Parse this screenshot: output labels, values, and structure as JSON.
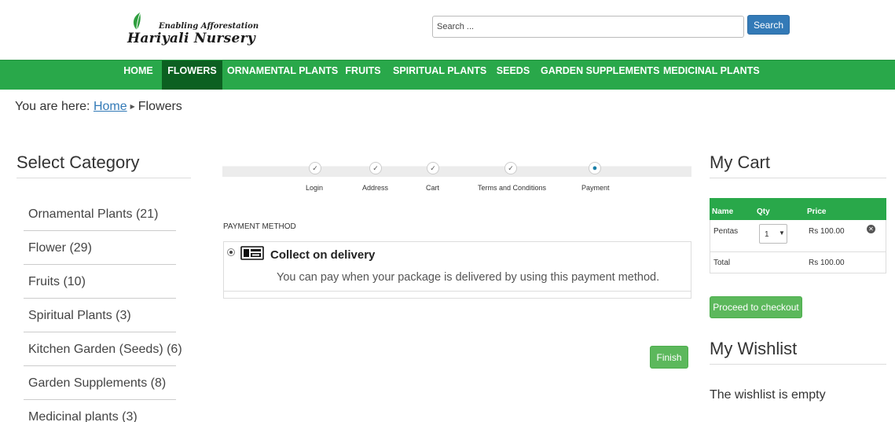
{
  "header": {
    "logo_tagline": "Enabling Afforestation",
    "logo_name": "Hariyali Nursery",
    "search_placeholder": "Search ...",
    "search_button": "Search"
  },
  "nav": {
    "items": [
      {
        "label": "HOME",
        "active": false
      },
      {
        "label": "FLOWERS",
        "active": true
      },
      {
        "label": "ORNAMENTAL PLANTS",
        "active": false
      },
      {
        "label": "FRUITS",
        "active": false
      },
      {
        "label": "SPIRITUAL PLANTS",
        "active": false
      },
      {
        "label": "SEEDS",
        "active": false
      },
      {
        "label": "GARDEN SUPPLEMENTS",
        "active": false
      },
      {
        "label": "MEDICINAL PLANTS",
        "active": false
      }
    ]
  },
  "breadcrumb": {
    "prefix": "You are here:",
    "home": "Home",
    "current": "Flowers"
  },
  "categories": {
    "title": "Select Category",
    "items": [
      "Ornamental Plants (21)",
      "Flower (29)",
      "Fruits (10)",
      "Spiritual Plants (3)",
      "Kitchen Garden (Seeds) (6)",
      "Garden Supplements (8)",
      "Medicinal plants (3)"
    ]
  },
  "checkout": {
    "steps": [
      {
        "label": "Login",
        "state": "done"
      },
      {
        "label": "Address",
        "state": "done"
      },
      {
        "label": "Cart",
        "state": "done"
      },
      {
        "label": "Terms and Conditions",
        "state": "done"
      },
      {
        "label": "Payment",
        "state": "current"
      }
    ],
    "payment_heading": "PAYMENT METHOD",
    "payment_option": {
      "title": "Collect on delivery",
      "description": "You can pay when your package is delivered by using this payment method.",
      "selected": true
    },
    "finish_button": "Finish"
  },
  "cart": {
    "title": "My Cart",
    "columns": {
      "name": "Name",
      "qty": "Qty",
      "price": "Price"
    },
    "items": [
      {
        "name": "Pentas",
        "qty": "1",
        "price": "Rs 100.00"
      }
    ],
    "total_label": "Total",
    "total_value": "Rs 100.00",
    "checkout_button": "Proceed to checkout"
  },
  "wishlist": {
    "title": "My Wishlist",
    "empty_text": "The wishlist is empty"
  },
  "colors": {
    "nav_green": "#29a84a",
    "nav_active": "#0c6021",
    "button_green": "#5cb85c",
    "button_blue": "#337ab7"
  }
}
